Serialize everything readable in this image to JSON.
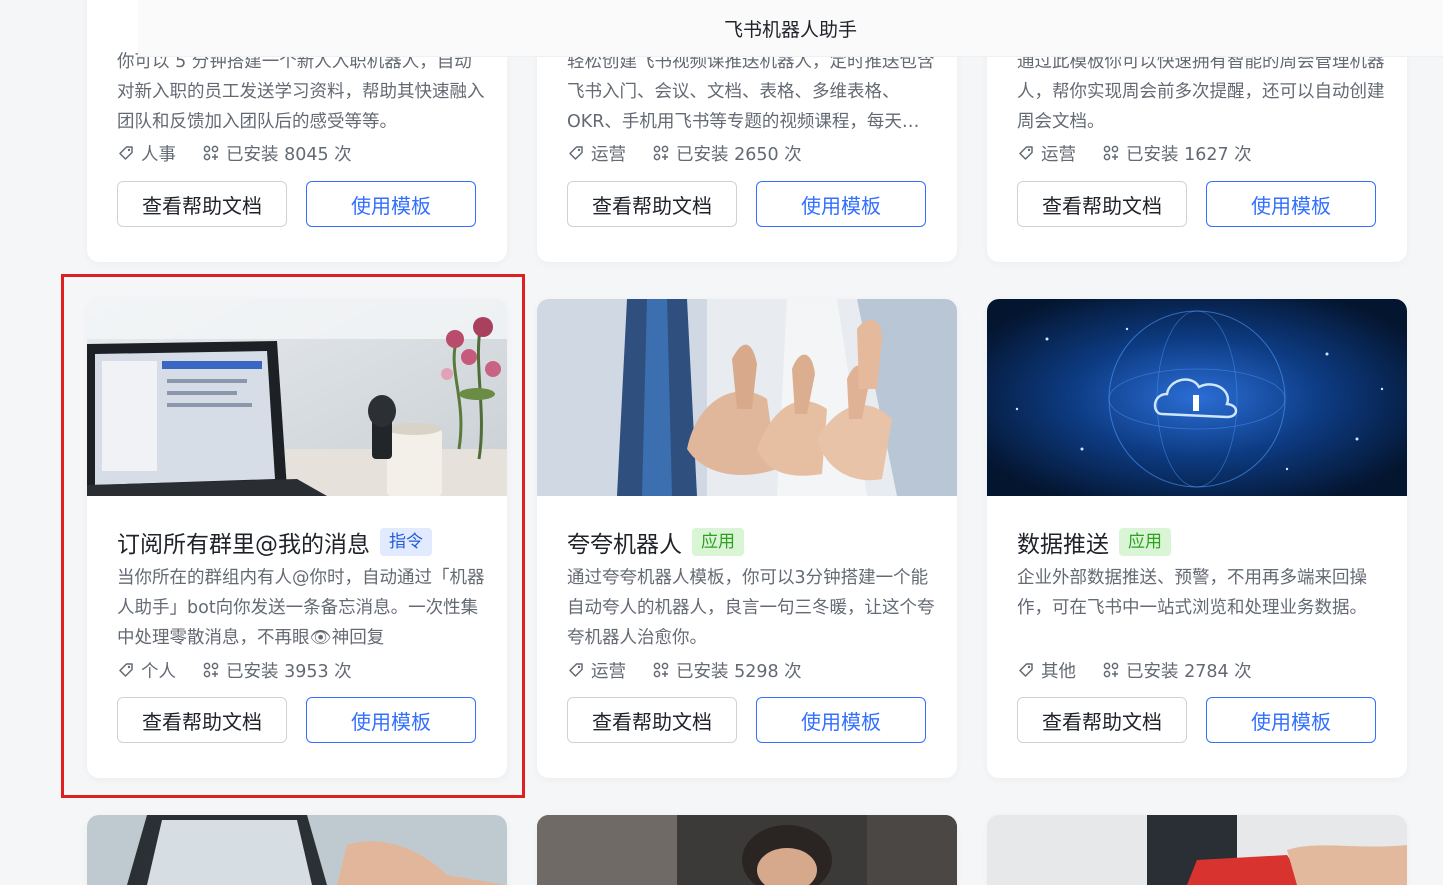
{
  "header": {
    "title": "飞书机器人助手"
  },
  "cards": [
    {
      "desc": "你可以 5 分钟搭建一个新人入职机器人，自动对新入职的员工发送学习资料，帮助其快速融入团队和反馈加入团队后的感受等等。",
      "category": "人事",
      "installs": "已安装 8045 次"
    },
    {
      "desc": "轻松创建飞书视频课推送机器人，定时推送包含飞书入门、会议、文档、表格、多维表格、OKR、手机用飞书等专题的视频课程，每天…",
      "category": "运营",
      "installs": "已安装 2650 次"
    },
    {
      "desc": "通过此模板你可以快速拥有智能的周会管理机器人，帮你实现周会前多次提醒，还可以自动创建周会文档。",
      "category": "运营",
      "installs": "已安装 1627 次"
    },
    {
      "title": "订阅所有群里@我的消息",
      "tag": "指令",
      "desc": "当你所在的群组内有人@你时，自动通过「机器人助手」bot向你发送一条备忘消息。一次性集中处理零散消息，不再眼👁神回复",
      "category": "个人",
      "installs": "已安装 3953 次"
    },
    {
      "title": "夸夸机器人",
      "tag": "应用",
      "desc": "通过夸夸机器人模板，你可以3分钟搭建一个能自动夸人的机器人，良言一句三冬暖，让这个夸夸机器人治愈你。",
      "category": "运营",
      "installs": "已安装 5298 次"
    },
    {
      "title": "数据推送",
      "tag": "应用",
      "desc": "企业外部数据推送、预警，不用再多端来回操作，可在飞书中一站式浏览和处理业务数据。",
      "category": "其他",
      "installs": "已安装 2784 次"
    }
  ],
  "buttons": {
    "help": "查看帮助文档",
    "use": "使用模板"
  },
  "colors": {
    "primary": "#3370ff",
    "highlight": "#e02020",
    "tag_blue_bg": "#e1eaff",
    "tag_green_bg": "#d9f5d6"
  },
  "icons": {
    "category": "tag-icon",
    "installs": "installs-icon"
  }
}
